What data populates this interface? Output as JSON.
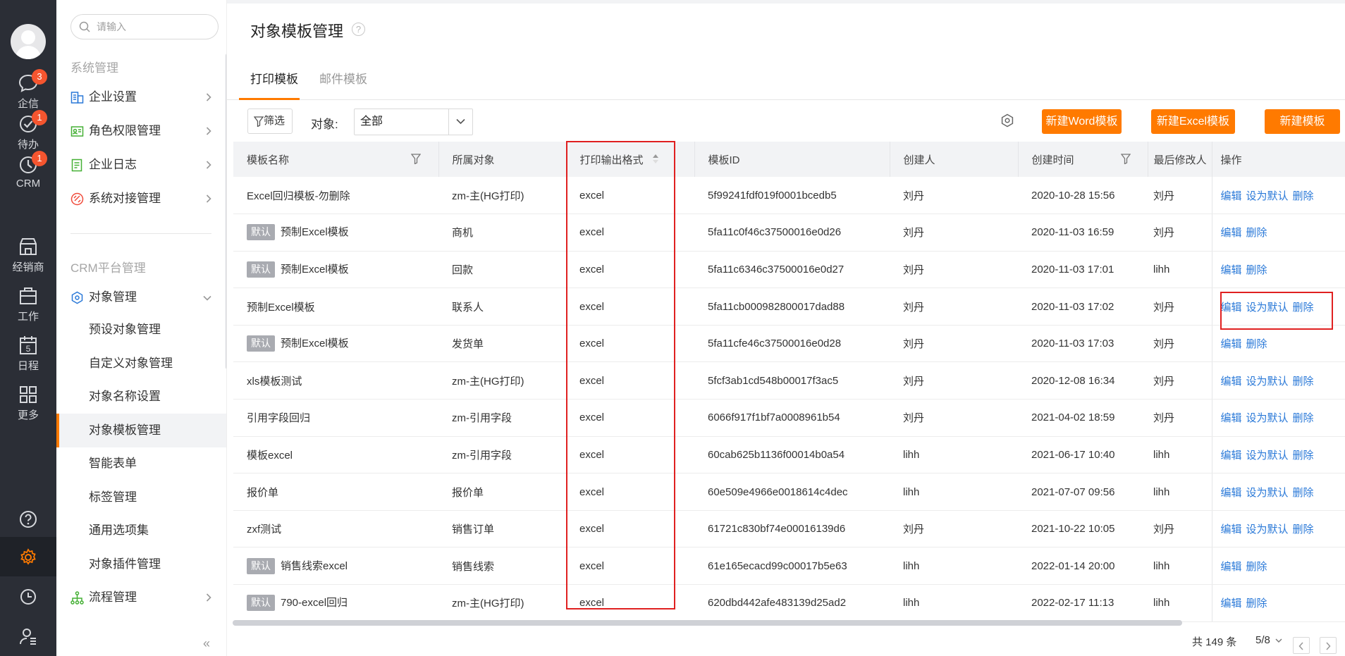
{
  "rail": {
    "items": [
      {
        "label": "企信",
        "badge": "3"
      },
      {
        "label": "待办",
        "badge": "1"
      },
      {
        "label": "CRM",
        "badge": "1"
      },
      {
        "label": "经销商"
      },
      {
        "label": "工作"
      },
      {
        "label": "日程",
        "day": "5"
      },
      {
        "label": "更多"
      }
    ]
  },
  "nav": {
    "search_placeholder": "请输入",
    "section1": "系统管理",
    "items1": [
      {
        "label": "企业设置"
      },
      {
        "label": "角色权限管理"
      },
      {
        "label": "企业日志"
      },
      {
        "label": "系统对接管理"
      }
    ],
    "section2": "CRM平台管理",
    "object_mgmt": "对象管理",
    "sub_items": [
      {
        "label": "预设对象管理"
      },
      {
        "label": "自定义对象管理"
      },
      {
        "label": "对象名称设置"
      },
      {
        "label": "对象模板管理"
      },
      {
        "label": "智能表单"
      },
      {
        "label": "标签管理"
      },
      {
        "label": "通用选项集"
      },
      {
        "label": "对象插件管理"
      }
    ],
    "flow_mgmt": "流程管理",
    "collapse": "«"
  },
  "page": {
    "title": "对象模板管理",
    "help": "?",
    "tabs": [
      {
        "label": "打印模板",
        "active": true
      },
      {
        "label": "邮件模板",
        "active": false
      }
    ],
    "filter_label": "筛选",
    "object_label": "对象:",
    "object_value": "全部",
    "buttons": {
      "new_word": "新建Word模板",
      "new_excel": "新建Excel模板",
      "new_template": "新建模板"
    }
  },
  "table": {
    "columns": [
      "模板名称",
      "所属对象",
      "打印输出格式",
      "模板ID",
      "创建人",
      "创建时间",
      "最后修改人",
      "操作"
    ],
    "rows": [
      {
        "tag": "",
        "name": "Excel回归模板-勿删除",
        "object": "zm-主(HG打印)",
        "format": "excel",
        "id": "5f99241fdf019f0001bcedb5",
        "creator": "刘丹",
        "created": "2020-10-28 15:56",
        "modifier": "刘丹",
        "actions": [
          "编辑",
          "设为默认",
          "删除"
        ]
      },
      {
        "tag": "默认",
        "name": "预制Excel模板",
        "object": "商机",
        "format": "excel",
        "id": "5fa11c0f46c37500016e0d26",
        "creator": "刘丹",
        "created": "2020-11-03 16:59",
        "modifier": "刘丹",
        "actions": [
          "编辑",
          "删除"
        ]
      },
      {
        "tag": "默认",
        "name": "预制Excel模板",
        "object": "回款",
        "format": "excel",
        "id": "5fa11c6346c37500016e0d27",
        "creator": "刘丹",
        "created": "2020-11-03 17:01",
        "modifier": "lihh",
        "actions": [
          "编辑",
          "删除"
        ]
      },
      {
        "tag": "",
        "name": "预制Excel模板",
        "object": "联系人",
        "format": "excel",
        "id": "5fa11cb000982800017dad88",
        "creator": "刘丹",
        "created": "2020-11-03 17:02",
        "modifier": "刘丹",
        "actions": [
          "编辑",
          "设为默认",
          "删除"
        ]
      },
      {
        "tag": "默认",
        "name": "预制Excel模板",
        "object": "发货单",
        "format": "excel",
        "id": "5fa11cfe46c37500016e0d28",
        "creator": "刘丹",
        "created": "2020-11-03 17:03",
        "modifier": "刘丹",
        "actions": [
          "编辑",
          "删除"
        ]
      },
      {
        "tag": "",
        "name": "xls模板测试",
        "object": "zm-主(HG打印)",
        "format": "excel",
        "id": "5fcf3ab1cd548b00017f3ac5",
        "creator": "刘丹",
        "created": "2020-12-08 16:34",
        "modifier": "刘丹",
        "actions": [
          "编辑",
          "设为默认",
          "删除"
        ]
      },
      {
        "tag": "",
        "name": "引用字段回归",
        "object": "zm-引用字段",
        "format": "excel",
        "id": "6066f917f1bf7a0008961b54",
        "creator": "刘丹",
        "created": "2021-04-02 18:59",
        "modifier": "刘丹",
        "actions": [
          "编辑",
          "设为默认",
          "删除"
        ]
      },
      {
        "tag": "",
        "name": "模板excel",
        "object": "zm-引用字段",
        "format": "excel",
        "id": "60cab625b1136f00014b0a54",
        "creator": "lihh",
        "created": "2021-06-17 10:40",
        "modifier": "lihh",
        "actions": [
          "编辑",
          "设为默认",
          "删除"
        ]
      },
      {
        "tag": "",
        "name": "报价单",
        "object": "报价单",
        "format": "excel",
        "id": "60e509e4966e0018614c4dec",
        "creator": "lihh",
        "created": "2021-07-07 09:56",
        "modifier": "lihh",
        "actions": [
          "编辑",
          "设为默认",
          "删除"
        ]
      },
      {
        "tag": "",
        "name": "zxf测试",
        "object": "销售订单",
        "format": "excel",
        "id": "61721c830bf74e00016139d6",
        "creator": "刘丹",
        "created": "2021-10-22 10:05",
        "modifier": "刘丹",
        "actions": [
          "编辑",
          "设为默认",
          "删除"
        ]
      },
      {
        "tag": "默认",
        "name": "销售线索excel",
        "object": "销售线索",
        "format": "excel",
        "id": "61e165ecacd99c00017b5e63",
        "creator": "lihh",
        "created": "2022-01-14 20:00",
        "modifier": "lihh",
        "actions": [
          "编辑",
          "删除"
        ]
      },
      {
        "tag": "默认",
        "name": "790-excel回归",
        "object": "zm-主(HG打印)",
        "format": "excel",
        "id": "620dbd442afe483139d25ad2",
        "creator": "lihh",
        "created": "2022-02-17 11:13",
        "modifier": "lihh",
        "actions": [
          "编辑",
          "删除"
        ]
      }
    ]
  },
  "pagination": {
    "total": "共 149 条",
    "page": "5/8"
  },
  "colors": {
    "accent": "#ff7a00",
    "link": "#2a79d8",
    "highlight_box": "#e02020",
    "rail_bg": "#2b2e36"
  }
}
